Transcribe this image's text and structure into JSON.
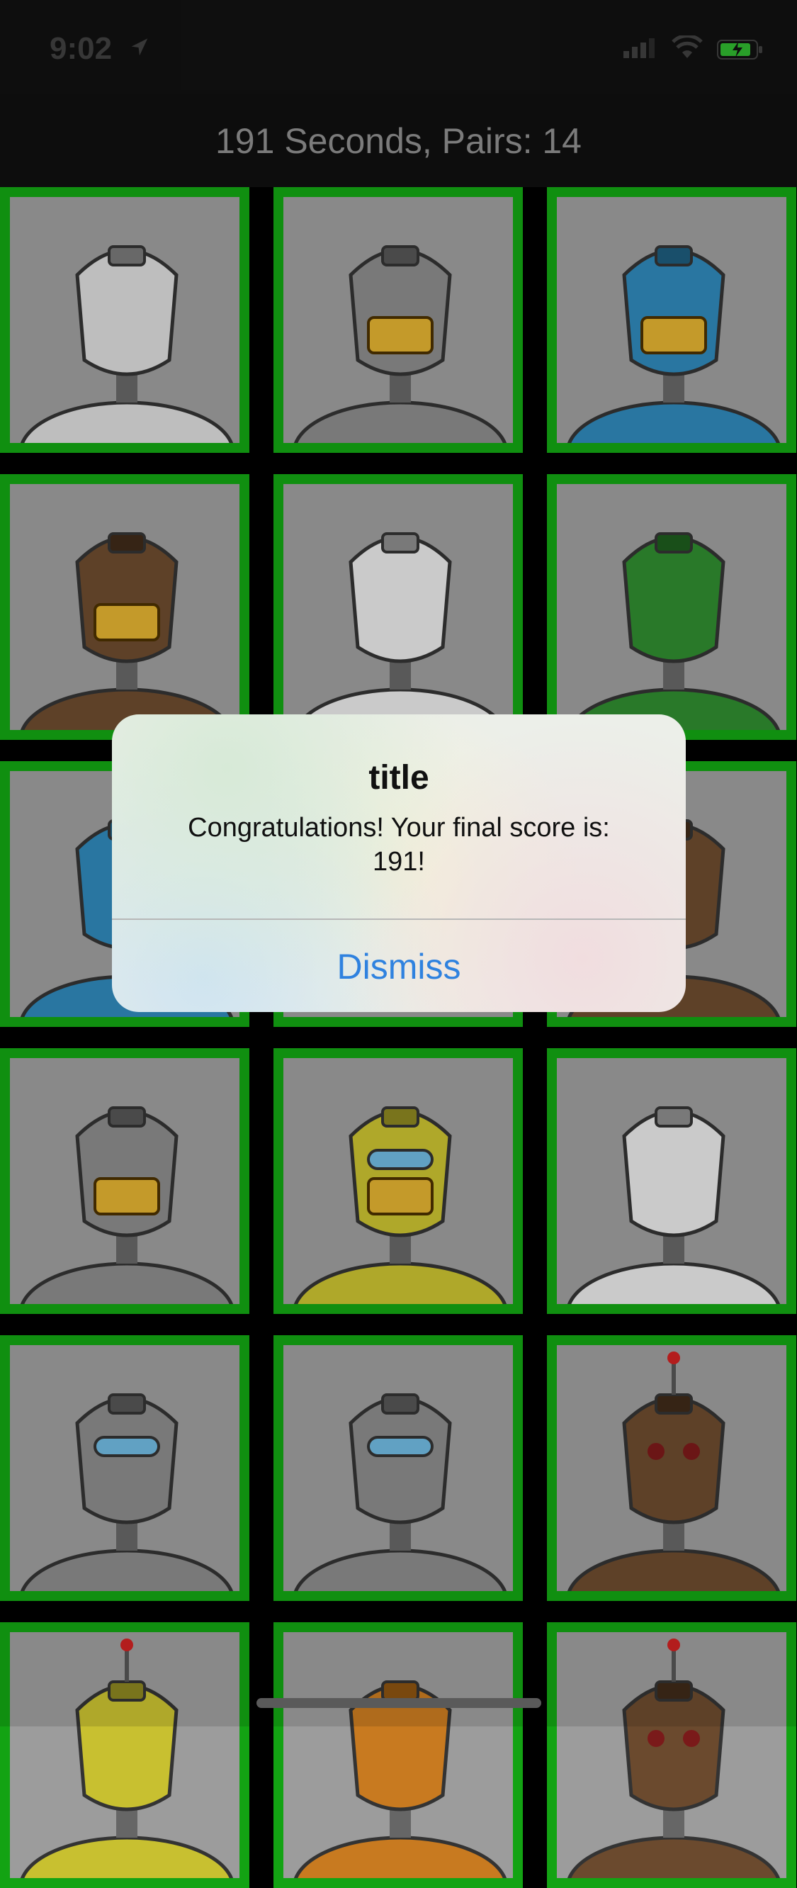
{
  "status": {
    "time": "9:02"
  },
  "header": {
    "title": "191 Seconds, Pairs: 14"
  },
  "cards": [
    {
      "variant": "silver-spike"
    },
    {
      "variant": "gray-grin"
    },
    {
      "variant": "blue-grin"
    },
    {
      "variant": "brown-pot"
    },
    {
      "variant": "white-capsule"
    },
    {
      "variant": "green-bottle"
    },
    {
      "variant": "blue-antenna"
    },
    {
      "variant": "hidden"
    },
    {
      "variant": "brown-side"
    },
    {
      "variant": "gray-grin"
    },
    {
      "variant": "yellow-visor"
    },
    {
      "variant": "white-capsule"
    },
    {
      "variant": "gray-visor"
    },
    {
      "variant": "gray-visor"
    },
    {
      "variant": "brown-eyes"
    },
    {
      "variant": "yellow-antenna"
    },
    {
      "variant": "orange-dome"
    },
    {
      "variant": "brown-eyes"
    }
  ],
  "alert": {
    "title": "title",
    "message": "Congratulations! Your final score is: 191!",
    "button": "Dismiss"
  },
  "colors": {
    "card_border": "#13a313",
    "card_bg": "#9c9c9c",
    "button_text": "#2f82df"
  }
}
